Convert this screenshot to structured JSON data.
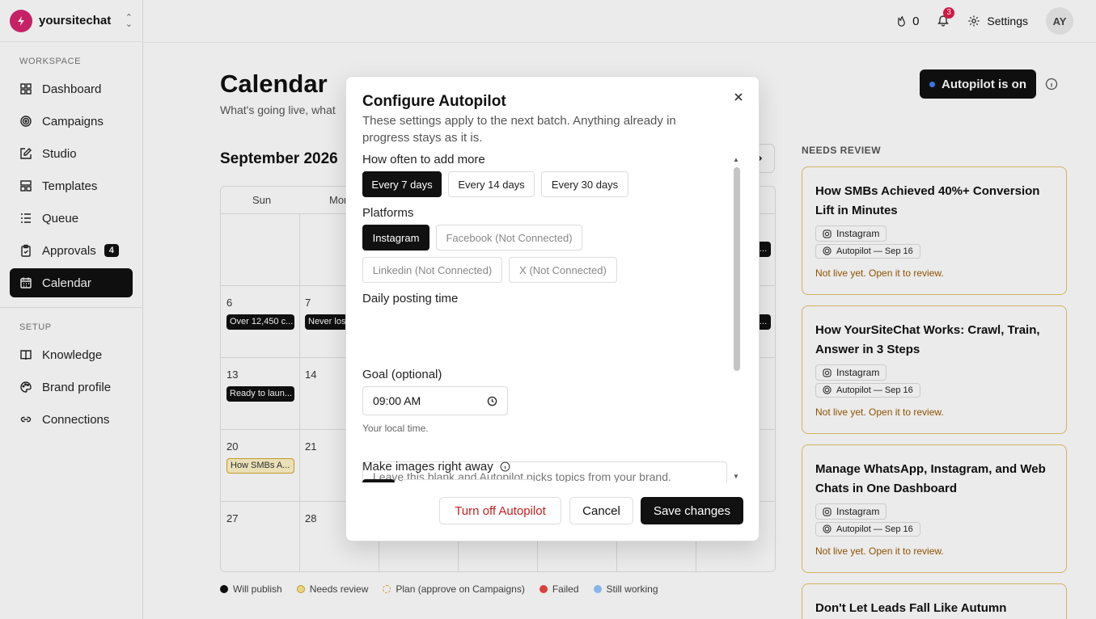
{
  "brand": {
    "name": "yoursitechat"
  },
  "sidebar": {
    "workspace_title": "WORKSPACE",
    "setup_title": "SETUP",
    "workspace_items": [
      {
        "label": "Dashboard",
        "icon": "dashboard-icon"
      },
      {
        "label": "Campaigns",
        "icon": "target-icon"
      },
      {
        "label": "Studio",
        "icon": "edit-icon"
      },
      {
        "label": "Templates",
        "icon": "template-icon"
      },
      {
        "label": "Queue",
        "icon": "list-icon"
      },
      {
        "label": "Approvals",
        "icon": "clipboard-icon",
        "badge": "4"
      },
      {
        "label": "Calendar",
        "icon": "calendar-icon",
        "active": true
      }
    ],
    "setup_items": [
      {
        "label": "Knowledge",
        "icon": "book-icon"
      },
      {
        "label": "Brand profile",
        "icon": "palette-icon"
      },
      {
        "label": "Connections",
        "icon": "link-icon"
      }
    ]
  },
  "topbar": {
    "streak": "0",
    "notifications": "3",
    "settings_label": "Settings",
    "avatar": "AY"
  },
  "main": {
    "title": "Calendar",
    "subtitle": "What's going live, what",
    "autopilot_label": "Autopilot is on",
    "month": "September 2026",
    "weekdays": [
      "Sun",
      "Mon"
    ],
    "days": [
      "6",
      "7",
      "13",
      "14",
      "20",
      "21",
      "27",
      "28"
    ],
    "chips": {
      "d6": "Over 12,450 c...",
      "d7": "Never lose",
      "d13": "Ready to laun...",
      "d20": "How SMBs A...",
      "edge": "..."
    }
  },
  "legend": [
    {
      "label": "Will publish",
      "color": "#111111"
    },
    {
      "label": "Needs review",
      "color": "#fde68a"
    },
    {
      "label": "Plan (approve on Campaigns)",
      "color": "#ffffff"
    },
    {
      "label": "Failed",
      "color": "#ef4444"
    },
    {
      "label": "Still working",
      "color": "#93c5fd"
    }
  ],
  "needs_review": {
    "title": "NEEDS REVIEW",
    "cards": [
      {
        "title": "How SMBs Achieved 40%+ Conversion Lift in Minutes",
        "platform": "Instagram",
        "source": "Autopilot — Sep 16",
        "status": "Not live yet. Open it to review."
      },
      {
        "title": "How YourSiteChat Works: Crawl, Train, Answer in 3 Steps",
        "platform": "Instagram",
        "source": "Autopilot — Sep 16",
        "status": "Not live yet. Open it to review."
      },
      {
        "title": "Manage WhatsApp, Instagram, and Web Chats in One Dashboard",
        "platform": "Instagram",
        "source": "Autopilot — Sep 16",
        "status": "Not live yet. Open it to review."
      },
      {
        "title": "Don't Let Leads Fall Like Autumn Leaves:"
      }
    ]
  },
  "modal": {
    "title": "Configure Autopilot",
    "description": "These settings apply to the next batch. Anything already in progress stays as it is.",
    "frequency_label": "How often to add more",
    "frequency_options": [
      "Every 7 days",
      "Every 14 days",
      "Every 30 days"
    ],
    "frequency_selected": "Every 7 days",
    "platforms_label": "Platforms",
    "platforms": [
      "Instagram",
      "Facebook (Not Connected)",
      "Linkedin (Not Connected)",
      "X (Not Connected)"
    ],
    "time_label": "Daily posting time",
    "time_value": "09:00 AM",
    "time_hint": "Your local time.",
    "goal_label": "Goal (optional)",
    "goal_placeholder": "Leave this blank and Autopilot picks topics from your brand.",
    "images_label": "Make images right away",
    "turn_off_label": "Turn off Autopilot",
    "cancel_label": "Cancel",
    "save_label": "Save changes"
  }
}
